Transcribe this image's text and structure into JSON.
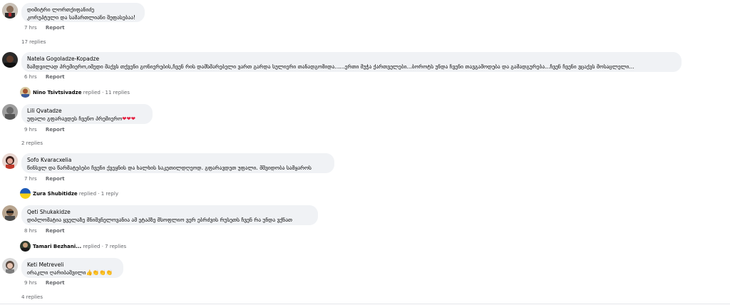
{
  "comments": [
    {
      "name": "დიმიტრი ლორთქიფანიძე",
      "text": "კორუპტული და სამართლიანი შეფასებაა!",
      "time": "7 hrs",
      "report": "Report",
      "replies": "17 replies"
    },
    {
      "name": "Natela Gogoladze-Kopadze",
      "text": "ზამდვილად პრემიერო,იმედი მაქვს თქვენი გონიერების,ჩვენ რის დამსმარებელი ვართ გარდა სულიერი თანადგომიდა......ერთი მუჭა ქართველები...ბოროტს უნდა ჩვენი თავგამოდება და გამადგურება...ჩვენ ჩვენი ვცაქვს მოსაცლელი...",
      "time": "6 hrs",
      "report": "Report",
      "replied_by": "Nino Tsivtsivadze",
      "replied_word": "replied",
      "replied_count": "· 11 replies"
    },
    {
      "name": "Lili Qvatadze",
      "text": "უფალი გფარავდეს ჩვენო პრემიერო",
      "hearts": "❤❤❤",
      "time": "9 hrs",
      "report": "Report",
      "replies": "2 replies"
    },
    {
      "name": "Sofo Kvaracxelia",
      "text": "წინსვლ და წარმატებები ჩვენი ქვეყნის და ხალხის საკეთილდღეოდ. გფარავდეთ უფალი. მშვიდობა სამყაროს",
      "time": "7 hrs",
      "report": "Report",
      "replied_by": "Zura Shubitidze",
      "replied_word": "replied",
      "replied_count": "· 1 reply"
    },
    {
      "name": "Qeti Shukakidze",
      "text": "დიპლომატია ყველაზე მნიშვნელოვანია ამ ეტაპზე მსოფლიო ვერ ებრძვის რუსეთს ჩვენ რა უნდა ვქნათ",
      "time": "8 hrs",
      "report": "Report",
      "replied_by": "Tamari Bezhani...",
      "replied_word": "replied",
      "replied_count": "· 7 replies"
    },
    {
      "name": "Keti Metreveli",
      "text": "ირაკლი ღარიბაშვილი",
      "emoji": "👍👏👏👏",
      "time": "9 hrs",
      "report": "Report",
      "replies": "4 replies"
    }
  ],
  "colors": {
    "bubble": "#f0f2f5",
    "meta": "#65676b",
    "heart": "#e41e3f"
  }
}
